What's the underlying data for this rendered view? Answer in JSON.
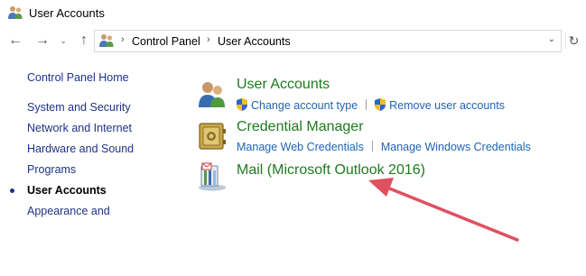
{
  "window": {
    "title": "User Accounts",
    "title_icon": "users-icon"
  },
  "navbar": {
    "back_icon": "back-arrow-icon",
    "forward_icon": "forward-arrow-icon",
    "recent_icon": "chevron-down-icon",
    "up_icon": "up-arrow-icon",
    "breadcrumb": [
      "Control Panel",
      "User Accounts"
    ],
    "refresh_icon": "refresh-icon"
  },
  "leftnav": {
    "items": [
      {
        "label": "Control Panel Home",
        "current": false
      },
      {
        "label": "System and Security",
        "current": false
      },
      {
        "label": "Network and Internet",
        "current": false
      },
      {
        "label": "Hardware and Sound",
        "current": false
      },
      {
        "label": "Programs",
        "current": false
      },
      {
        "label": "User Accounts",
        "current": true
      },
      {
        "label": "Appearance and",
        "current": false
      }
    ]
  },
  "main": {
    "sections": [
      {
        "title": "User Accounts",
        "icon": "user-accounts-icon",
        "links": [
          {
            "label": "Change account type",
            "shield": true
          },
          {
            "label": "Remove user accounts",
            "shield": true
          }
        ]
      },
      {
        "title": "Credential Manager",
        "icon": "credential-vault-icon",
        "links": [
          {
            "label": "Manage Web Credentials",
            "shield": false
          },
          {
            "label": "Manage Windows Credentials",
            "shield": false
          }
        ]
      },
      {
        "title": "Mail (Microsoft Outlook 2016)",
        "icon": "mail-icon",
        "links": []
      }
    ]
  },
  "colors": {
    "section_title": "#1e7a1e",
    "link": "#1e64b4",
    "nav_link": "#1e3287",
    "annotation_arrow": "#e0505f"
  }
}
